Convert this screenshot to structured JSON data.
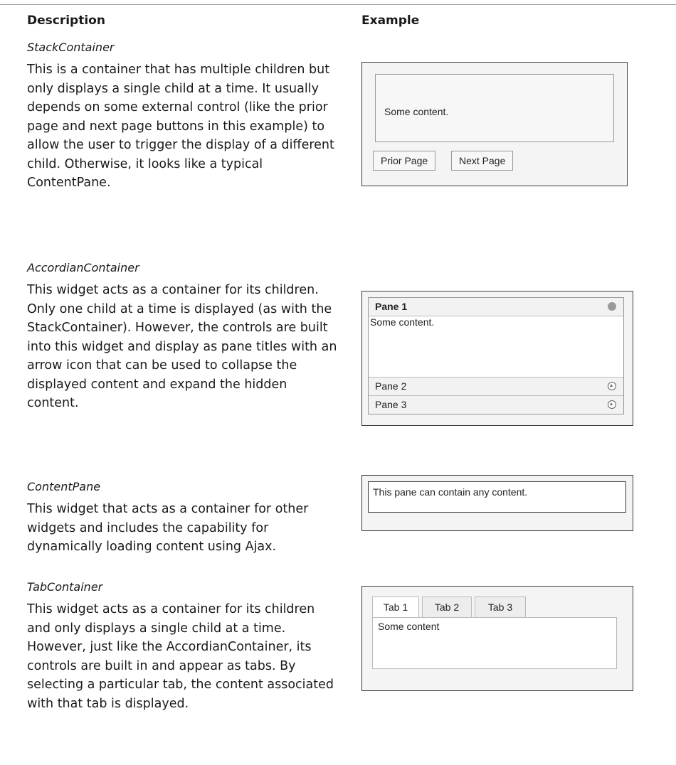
{
  "headers": {
    "description": "Description",
    "example": "Example"
  },
  "sections": [
    {
      "title": "StackContainer",
      "description": "This is a container that has multiple children but only displays a single child at a time. It usually depends on some external control (like the prior page and next page buttons in this example) to allow the user to trigger the display of a different child. Otherwise, it looks like a typical ContentPane.",
      "example": {
        "content": "Some content.",
        "prior_button": "Prior Page",
        "next_button": "Next Page"
      }
    },
    {
      "title": "AccordianContainer",
      "description": "This widget acts as a container for its children. Only one child at a time is displayed (as with the StackContainer). However, the controls are built into this widget and display as pane titles with an arrow icon that can be used to collapse the displayed content and expand the hidden content.",
      "example": {
        "panes": [
          {
            "title": "Pane 1",
            "icon": "dot-icon"
          },
          {
            "title": "Pane 2",
            "icon": "expand-arrow-icon"
          },
          {
            "title": "Pane 3",
            "icon": "expand-arrow-icon"
          }
        ],
        "content": "Some content."
      }
    },
    {
      "title": "ContentPane",
      "description": "This widget that acts as a container for other widgets and includes the capability for dynamically loading content using Ajax.",
      "example": {
        "content": "This pane can contain any content."
      }
    },
    {
      "title": "TabContainer",
      "description": "This widget acts as a container for its children and only displays a single child at a time. However, just like the AccordianContainer, its controls are built in and appear as tabs. By selecting a particular tab, the content associated with that tab is displayed.",
      "example": {
        "tabs": [
          "Tab 1",
          "Tab 2",
          "Tab 3"
        ],
        "content": "Some content"
      }
    }
  ]
}
